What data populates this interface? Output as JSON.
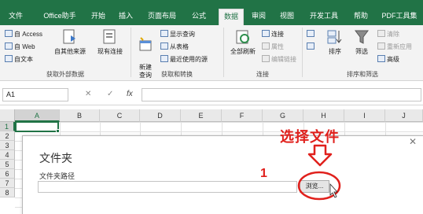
{
  "tabs": [
    {
      "label": "文件",
      "active": false
    },
    {
      "label": "Office助手",
      "active": false
    },
    {
      "label": "开始",
      "active": false
    },
    {
      "label": "插入",
      "active": false
    },
    {
      "label": "页面布局",
      "active": false
    },
    {
      "label": "公式",
      "active": false
    },
    {
      "label": "数据",
      "active": true
    },
    {
      "label": "审阅",
      "active": false
    },
    {
      "label": "视图",
      "active": false
    },
    {
      "label": "开发工具",
      "active": false
    },
    {
      "label": "帮助",
      "active": false
    },
    {
      "label": "PDF工具集",
      "active": false
    }
  ],
  "ribbon": {
    "get_external": {
      "access": "自 Access",
      "web": "自 Web",
      "text": "自文本",
      "other_sources": "自其他来源",
      "existing_connections": "现有连接",
      "label": "获取外部数据"
    },
    "get_transform": {
      "new_query": "新建\n查询",
      "show_queries": "显示查询",
      "from_table": "从表格",
      "recent_sources": "最近使用的源",
      "label": "获取和转换"
    },
    "connections": {
      "refresh_all": "全部刷新",
      "connections": "连接",
      "properties": "属性",
      "edit_links": "编辑链接",
      "label": "连接"
    },
    "sort_filter": {
      "sort": "排序",
      "filter": "筛选",
      "clear": "清除",
      "reapply": "重新应用",
      "advanced": "高级",
      "label": "排序和筛选"
    }
  },
  "formula_bar": {
    "name_box": "A1",
    "cancel": "✕",
    "enter": "✓",
    "fx": "fx",
    "value": ""
  },
  "grid": {
    "columns": [
      "A",
      "B",
      "C",
      "D",
      "E",
      "F",
      "G",
      "H",
      "I",
      "J"
    ],
    "rows": [
      "1",
      "2",
      "3",
      "4",
      "5",
      "6",
      "7",
      "8"
    ],
    "active_cell": "A1",
    "accent": "#217346"
  },
  "dialog": {
    "title": "文件夹",
    "path_label": "文件夹路径",
    "path_value": "",
    "browse_label": "浏览...",
    "close": "✕"
  },
  "annotations": {
    "title": "选择文件",
    "number": "1",
    "color": "#e0201c"
  }
}
